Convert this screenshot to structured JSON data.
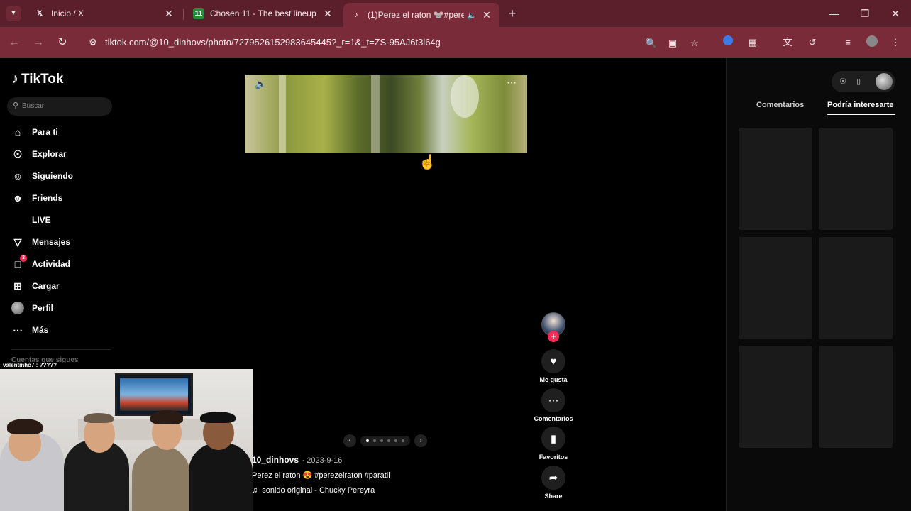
{
  "browser": {
    "tabs": [
      {
        "title": "Inicio / X",
        "icon": "x-logo-icon"
      },
      {
        "title": "Chosen 11 - The best lineup bu",
        "icon": "chosen11-icon"
      },
      {
        "title": "(1)Perez el raton 🐭#perez",
        "icon": "tiktok-icon"
      }
    ],
    "url": "tiktok.com/@10_dinhovs/photo/7279526152983645445?_r=1&_t=ZS-95AJ6t3l64g"
  },
  "tiktok": {
    "logo": "TikTok",
    "search_placeholder": "Buscar",
    "nav": [
      {
        "label": "Para ti",
        "icon": "home-icon"
      },
      {
        "label": "Explorar",
        "icon": "compass-icon"
      },
      {
        "label": "Siguiendo",
        "icon": "following-icon"
      },
      {
        "label": "Friends",
        "icon": "friends-icon"
      },
      {
        "label": "LIVE",
        "icon": "live-icon"
      },
      {
        "label": "Mensajes",
        "icon": "send-icon"
      },
      {
        "label": "Actividad",
        "icon": "activity-icon",
        "badge": "3"
      },
      {
        "label": "Cargar",
        "icon": "upload-icon"
      },
      {
        "label": "Perfil",
        "icon": "avatar"
      },
      {
        "label": "Más",
        "icon": "more-icon"
      }
    ],
    "following_header": "Cuentas que sigues",
    "chat_overlay": "valentinho7 : ?????",
    "post": {
      "username": "10_dinhovs",
      "date": "2023-9-16",
      "description": "Perez el raton 😍 #perezelraton #paratii",
      "music": "sonido original - Chucky Pereyra"
    },
    "actions": {
      "like": "Me gusta",
      "comment": "Comentarios",
      "favorite": "Favoritos",
      "share": "Share"
    },
    "right_tabs": {
      "comments": "Comentarios",
      "suggested": "Podría interesarte"
    }
  }
}
